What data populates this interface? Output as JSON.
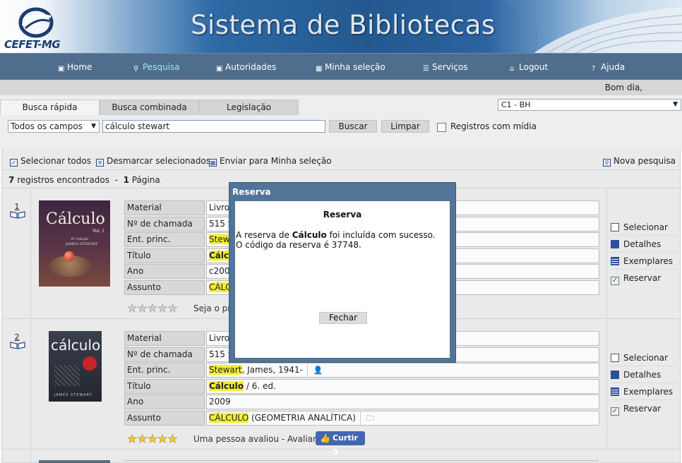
{
  "header": {
    "logo_text": "CEFET-MG",
    "title": "Sistema de Bibliotecas"
  },
  "nav": {
    "items": [
      {
        "label": "Home",
        "icon": "home-icon"
      },
      {
        "label": "Pesquisa",
        "icon": "pin-icon",
        "active": true
      },
      {
        "label": "Autoridades",
        "icon": "person-icon"
      },
      {
        "label": "Minha seleção",
        "icon": "grid-icon"
      },
      {
        "label": "Serviços",
        "icon": "list-icon"
      },
      {
        "label": "Logout",
        "icon": "logout-icon"
      },
      {
        "label": "Ajuda",
        "icon": "help-icon"
      }
    ]
  },
  "greeting": "Bom dia,",
  "tabs": [
    {
      "label": "Busca rápida",
      "active": true
    },
    {
      "label": "Busca combinada"
    },
    {
      "label": "Legislação"
    }
  ],
  "library_select": {
    "value": "C1 - BH"
  },
  "search": {
    "field_value": "Todos os campos",
    "query": "cálculo stewart",
    "search_button": "Buscar",
    "clear_button": "Limpar",
    "media_label": "Registros com mídia"
  },
  "actions": {
    "select_all": "Selecionar todos",
    "unselect": "Desmarcar selecionados",
    "send": "Enviar para Minha seleção",
    "new_search": "Nova pesquisa"
  },
  "results": {
    "count": "7",
    "count_text": "registros encontrados",
    "separator": "-",
    "pages": "1",
    "pages_text": "Página"
  },
  "field_labels": {
    "material": "Material",
    "call_number": "Nº de chamada",
    "main_entry": "Ent. princ.",
    "title": "Título",
    "year": "Ano",
    "subject": "Assunto"
  },
  "records": [
    {
      "number": "1",
      "cover_title": "Cálculo",
      "cover_vol": "Vol. 1",
      "cover_ed": "6ª Edição",
      "cover_author": "James Stewart",
      "material": "Livro",
      "call_number": "515 S",
      "main_entry_hl": "Stew",
      "title_hl": "Cálcu",
      "year": "c2007",
      "subject_hl": "CÁLC",
      "rating_text": "Seja o pri"
    },
    {
      "number": "2",
      "cover_title": "cálculo",
      "cover_author": "James Stewart",
      "material": "Livro",
      "call_number": "515 S",
      "main_entry_hl": "Stewart",
      "main_entry_rest": ", James, 1941-",
      "title_hl": "Cálculo",
      "title_rest": " / 6. ed.",
      "year": "2009",
      "subject_hl": "CÁLCULO",
      "subject_rest": " (GEOMETRIA ANALÍTICA)",
      "rating_text": "Uma pessoa avaliou - Avaliar",
      "like_label": "Curtir 0"
    }
  ],
  "side_actions": {
    "select": "Selecionar",
    "details": "Detalhes",
    "copies": "Exemplares",
    "reserve": "Reservar"
  },
  "modal": {
    "title": "Reserva",
    "heading": "Reserva",
    "msg_prefix": "A reserva de ",
    "msg_bold": "Cálculo",
    "msg_suffix": " foi incluída com sucesso.",
    "msg_line2": "O código da reserva é 37748.",
    "close_button": "Fechar"
  },
  "colors": {
    "nav_bg": "#4f6e8e",
    "highlight": "#f1ee34",
    "modal_frame": "#527498",
    "like_button": "#4267b2"
  }
}
